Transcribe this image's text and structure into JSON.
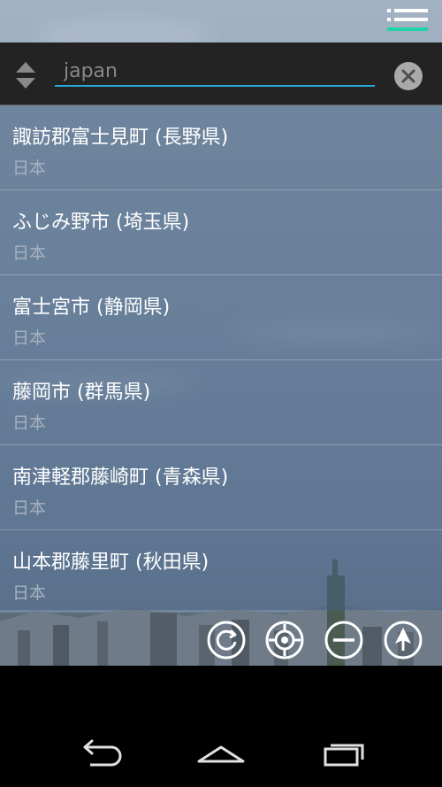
{
  "search": {
    "value": "",
    "placeholder": "japan"
  },
  "results": [
    {
      "name": "諏訪郡富士見町 (長野県)",
      "country": "日本"
    },
    {
      "name": "ふじみ野市 (埼玉県)",
      "country": "日本"
    },
    {
      "name": "富士宮市 (静岡県)",
      "country": "日本"
    },
    {
      "name": "藤岡市 (群馬県)",
      "country": "日本"
    },
    {
      "name": "南津軽郡藤崎町 (青森県)",
      "country": "日本"
    },
    {
      "name": "山本郡藤里町 (秋田県)",
      "country": "日本"
    }
  ],
  "icons": {
    "menu": "list-menu-icon",
    "sort": "sort-arrows-icon",
    "clear": "clear-circle-icon",
    "refresh": "refresh-icon",
    "locate": "locate-target-icon",
    "remove": "remove-minus-icon",
    "navigate": "navigate-arrow-icon",
    "back": "back-icon",
    "home": "home-icon",
    "recents": "recent-apps-icon"
  },
  "colors": {
    "accent": "#1fd3a7",
    "input_underline": "#29a7d4",
    "list_bg": "#465f7d",
    "search_bg": "#232323"
  }
}
